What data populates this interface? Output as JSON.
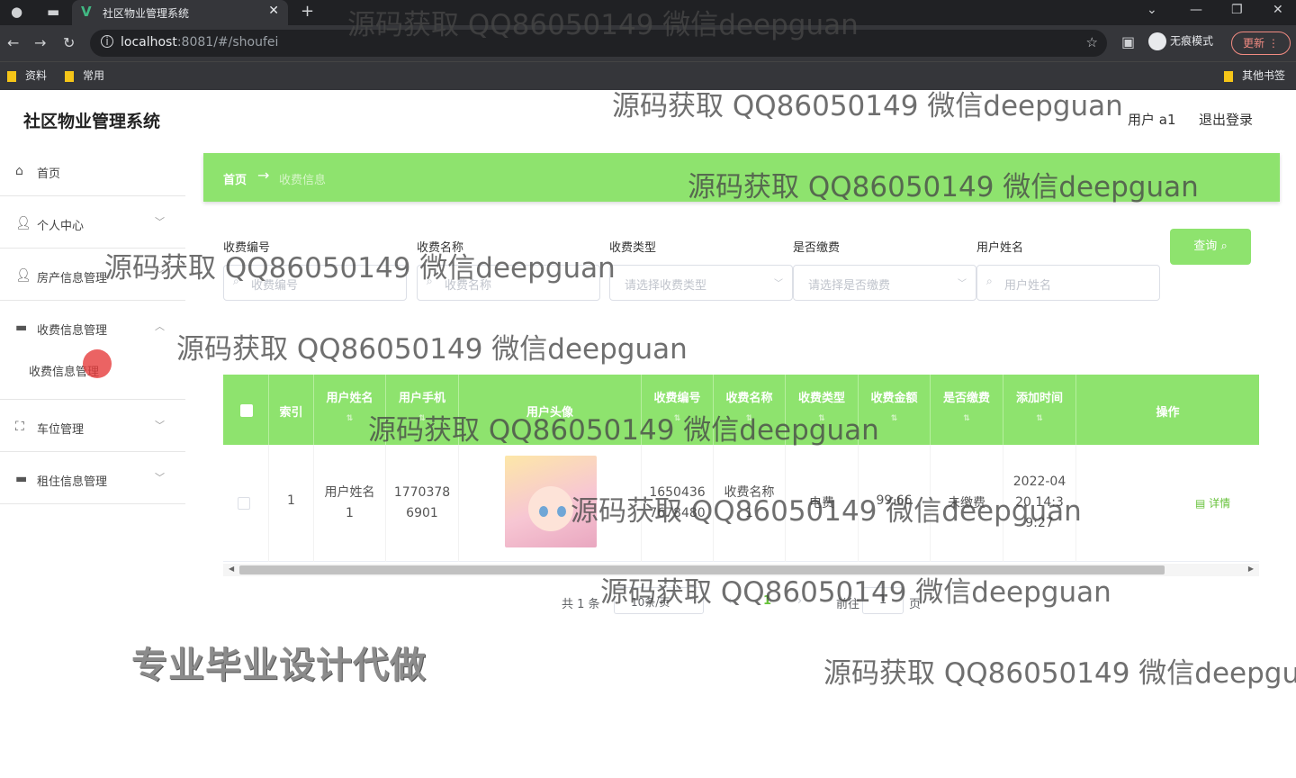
{
  "browser": {
    "tab_title": "社区物业管理系统",
    "url_host": "localhost",
    "url_rest": ":8081/#/shoufei",
    "incognito_label": "无痕模式",
    "update_label": "更新",
    "bookmarks": [
      "资料",
      "常用"
    ],
    "other_bookmarks": "其他书签"
  },
  "header": {
    "brand": "社区物业管理系统",
    "user": "用户 a1",
    "logout": "退出登录"
  },
  "sidebar": {
    "items": [
      {
        "label": "首页"
      },
      {
        "label": "个人中心"
      },
      {
        "label": "房产信息管理"
      },
      {
        "label": "收费信息管理"
      }
    ],
    "sub_item": "收费信息管理",
    "items2": [
      {
        "label": "车位管理"
      },
      {
        "label": "租住信息管理"
      }
    ]
  },
  "breadcrumb": {
    "home": "首页",
    "current": "收费信息"
  },
  "filters": {
    "labels": [
      "收费编号",
      "收费名称",
      "收费类型",
      "是否缴费",
      "用户姓名"
    ],
    "placeholders": [
      "收费编号",
      "收费名称",
      "请选择收费类型",
      "请选择是否缴费",
      "用户姓名"
    ],
    "query_button": "查询"
  },
  "table": {
    "headers": [
      "索引",
      "用户姓名",
      "用户手机",
      "用户头像",
      "收费编号",
      "收费名称",
      "收费类型",
      "收费金额",
      "是否缴费",
      "添加时间",
      "操作"
    ],
    "row": {
      "index": "1",
      "user_name_1": "用户姓名",
      "user_name_2": "1",
      "phone_1": "1770378",
      "phone_2": "6901",
      "fee_no_1": "1650436",
      "fee_no_2": "7678480",
      "fee_name_1": "收费名称",
      "fee_name_2": "1",
      "fee_type": "电费",
      "amount": "99.66",
      "paid": "未缴费",
      "time_1": "2022-04",
      "time_2": "20 14:3",
      "time_3": "9:27",
      "action": "详情"
    }
  },
  "pagination": {
    "total": "共 1 条",
    "page_size": "10条/页",
    "current": "1",
    "goto_label": "前往",
    "goto_value": "1",
    "page_unit": "页"
  },
  "watermarks": {
    "text": "源码获取 QQ86050149 微信deepguan",
    "promo": "专业毕业设计代做"
  },
  "colors": {
    "accent": "#8ee36e",
    "success": "#67c23a"
  }
}
